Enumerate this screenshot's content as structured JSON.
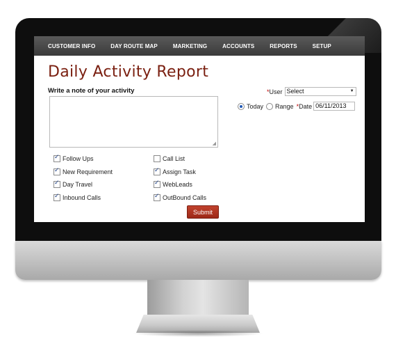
{
  "nav": {
    "items": [
      {
        "label": "CUSTOMER INFO"
      },
      {
        "label": "DAY ROUTE MAP"
      },
      {
        "label": "MARKETING"
      },
      {
        "label": "ACCOUNTS"
      },
      {
        "label": "REPORTS"
      },
      {
        "label": "SETUP"
      }
    ]
  },
  "page": {
    "title": "Daily Activity Report",
    "note_label": "Write a note of your activity",
    "note_value": ""
  },
  "filters": {
    "required_mark": "*",
    "user_label": "User",
    "user_value": "Select",
    "today_label": "Today",
    "range_label": "Range",
    "date_label": "Date",
    "date_value": "06/11/2013",
    "selected_mode": "Today"
  },
  "activities": {
    "col1": [
      {
        "label": "Follow Ups",
        "checked": true
      },
      {
        "label": "New Requirement",
        "checked": true
      },
      {
        "label": "Day Travel",
        "checked": true
      },
      {
        "label": "Inbound Calls",
        "checked": true
      }
    ],
    "col2": [
      {
        "label": "Call List",
        "checked": false
      },
      {
        "label": "Assign Task",
        "checked": true
      },
      {
        "label": "WebLeads",
        "checked": true
      },
      {
        "label": "OutBound Calls",
        "checked": true
      }
    ]
  },
  "submit_label": "Submit",
  "colors": {
    "title": "#7a1f10",
    "nav_bg": "#3a3a3a",
    "submit_bg": "#b0321f",
    "required": "#c00000"
  }
}
